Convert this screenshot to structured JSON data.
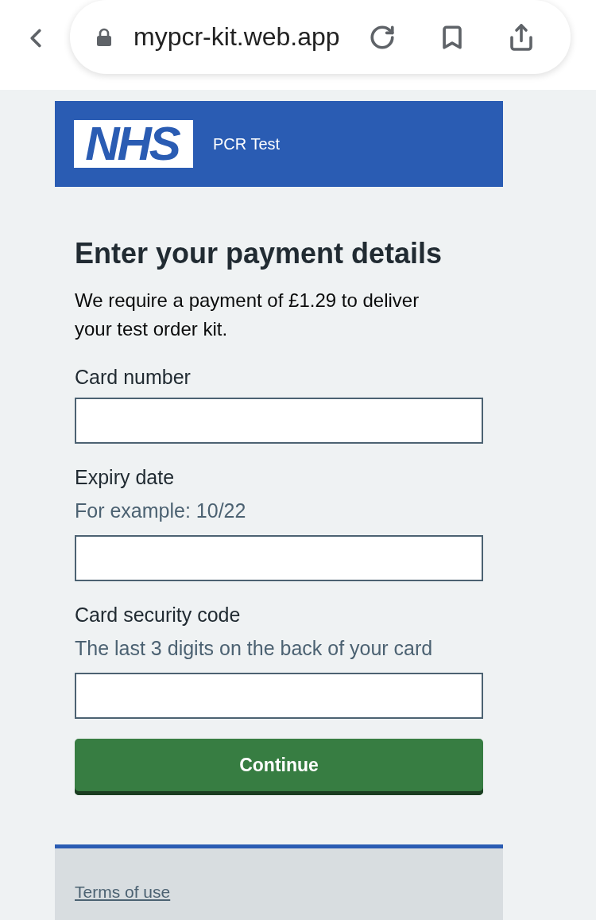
{
  "browser_bar": {
    "url": "mypcr-kit.web.app",
    "secure": true
  },
  "header": {
    "logo": "NHS",
    "service_name": "PCR Test"
  },
  "main": {
    "heading": "Enter your payment details",
    "intro": "We require a payment of £1.29 to deliver your test order kit.",
    "fields": [
      {
        "label": "Card number"
      },
      {
        "label": "Expiry date",
        "hint": "For example: 10/22"
      },
      {
        "label": "Card security code",
        "hint": "The last 3 digits on the back of your card"
      }
    ],
    "button": "Continue"
  },
  "footer": {
    "links": [
      "Terms of use"
    ]
  }
}
